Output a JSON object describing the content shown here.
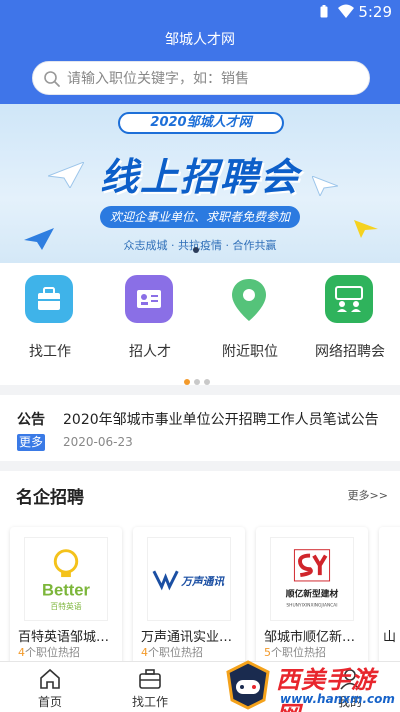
{
  "status": {
    "time": "5:29"
  },
  "header": {
    "title": "邹城人才网"
  },
  "search": {
    "placeholder": "请输入职位关键字，如：销售"
  },
  "banner": {
    "pill": "2020邹城人才网",
    "title": "线上招聘会",
    "subtitle": "欢迎企事业单位、求职者免费参加",
    "footer": "众志成城 · 共抗疫情 · 合作共赢"
  },
  "menu": {
    "items": [
      {
        "label": "找工作",
        "icon": "briefcase-icon",
        "color": "#3fb3e9"
      },
      {
        "label": "招人才",
        "icon": "id-card-icon",
        "color": "#8a6fe6"
      },
      {
        "label": "附近职位",
        "icon": "location-pin-icon",
        "color": "#55c37a"
      },
      {
        "label": "网络招聘会",
        "icon": "group-chat-icon",
        "color": "#2fb35c"
      }
    ]
  },
  "notice": {
    "tag": "公告",
    "badge": "更多",
    "title": "2020年邹城市事业单位公开招聘工作人员笔试公告",
    "date": "2020-06-23"
  },
  "famous": {
    "title": "名企招聘",
    "more": "更多>>",
    "companies": [
      {
        "name": "百特英语邹城校区",
        "count": "4",
        "suffix": "个职位热招",
        "logo_text": "Better",
        "logo_sub": "百特英语"
      },
      {
        "name": "万声通讯实业有限公司",
        "count": "4",
        "suffix": "个职位热招",
        "logo_text": "万声通讯"
      },
      {
        "name": "邹城市顺亿新型建材",
        "count": "5",
        "suffix": "个职位热招",
        "logo_text": "顺亿新型建材",
        "logo_sub": "SHUNYIXINXINGJIANCAI"
      },
      {
        "name": "山",
        "count": "",
        "suffix": ""
      }
    ]
  },
  "bottomnav": {
    "items": [
      {
        "label": "首页",
        "icon": "home-icon"
      },
      {
        "label": "找工作",
        "icon": "briefcase-icon"
      },
      {
        "label": "",
        "icon": ""
      },
      {
        "label": "我的",
        "icon": "user-icon"
      }
    ]
  },
  "watermark": {
    "cn": "西美手游网",
    "url": "www.hanxm.com"
  },
  "colors": {
    "primary": "#3f75e9",
    "accent": "#f39a2b"
  }
}
